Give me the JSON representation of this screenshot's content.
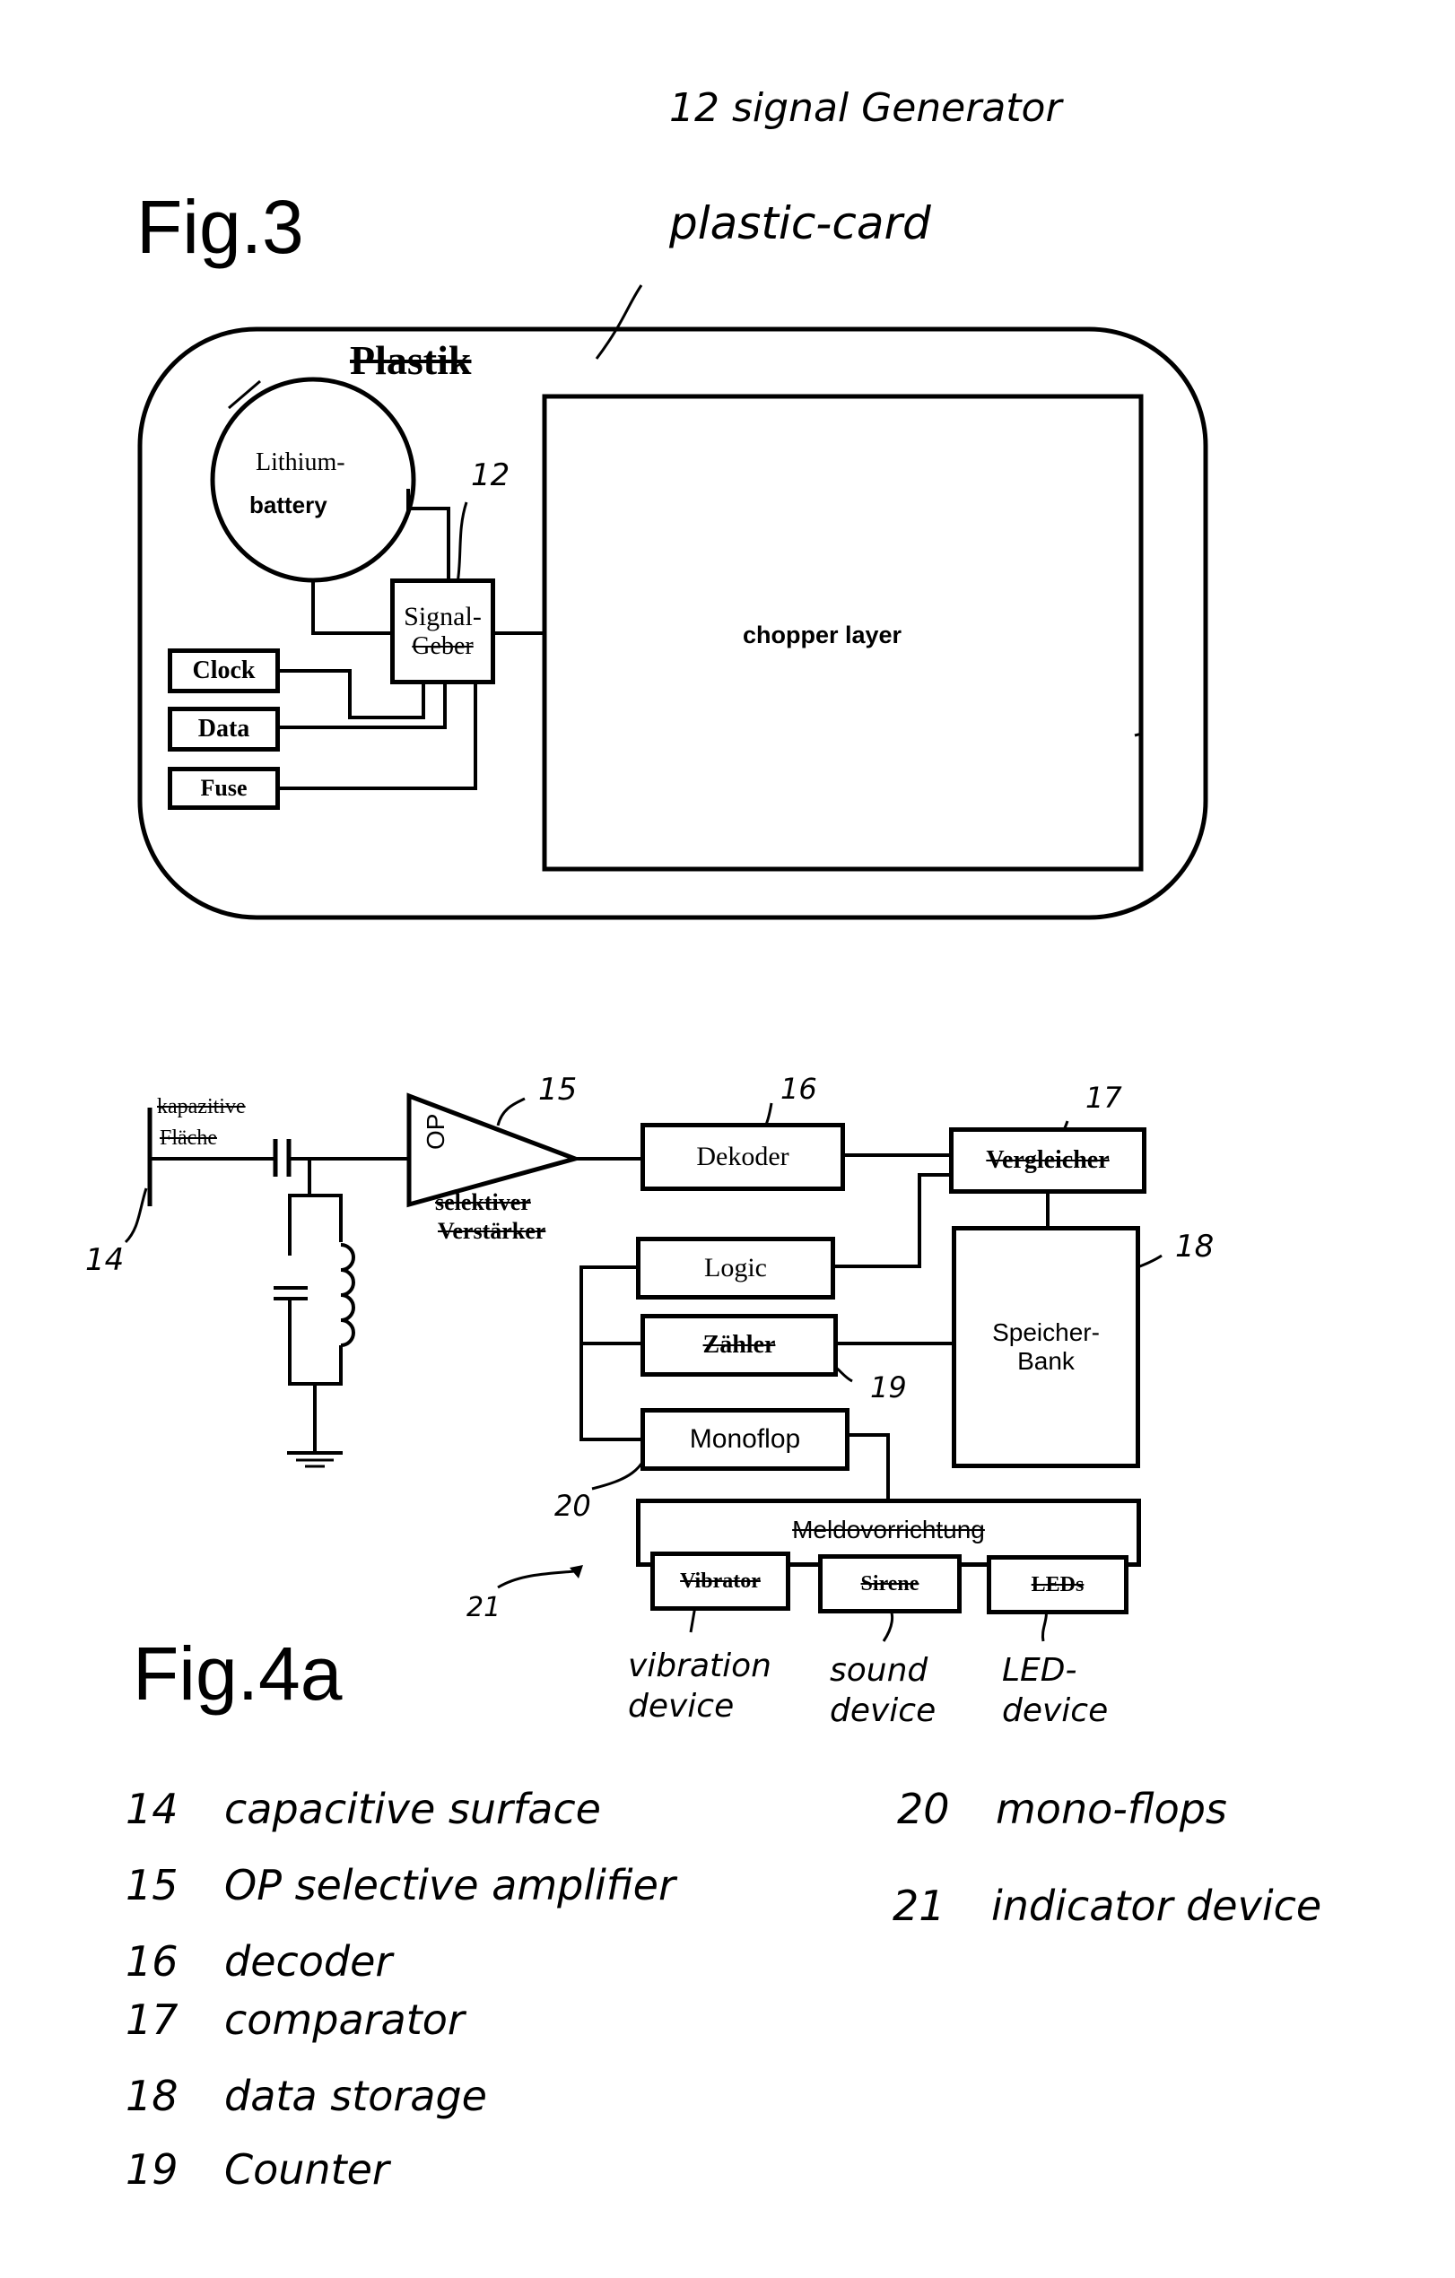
{
  "fig3": {
    "title": "Fig.3",
    "annotation_top": "12   signal  Generator",
    "annotation_card": "plastic-card",
    "card_label": "Plastik",
    "battery_line1": "Lithium-",
    "battery_line2": "battery",
    "signal_ref": "12",
    "signal_line1": "Signal-",
    "signal_line2": "Geber",
    "clock": "Clock",
    "data": "Data",
    "fuse": "Fuse",
    "chopper": "chopper layer"
  },
  "fig4a": {
    "title": "Fig.4a",
    "surface_line1": "kapazitive",
    "surface_line2": "Fläche",
    "ref14": "14",
    "op": "OP",
    "ref15": "15",
    "amp_line1": "selektiver",
    "amp_line2": "Verstärker",
    "decoder": "Dekoder",
    "ref16": "16",
    "comparator": "Vergleicher",
    "ref17": "17",
    "logic": "Logic",
    "counter": "Zähler",
    "ref19": "19",
    "monoflop": "Monoflop",
    "ref20": "20",
    "storage_line1": "Speicher-",
    "storage_line2": "Bank",
    "ref18": "18",
    "indicator": "Meldovorrichtung",
    "ref21": "21",
    "vibrator": "Vibrator",
    "sirene": "Sirene",
    "leds": "LEDs",
    "vibration_note_1": "vibration",
    "vibration_note_2": "device",
    "sound_note_1": "sound",
    "sound_note_2": "device",
    "led_note_1": "LED-",
    "led_note_2": "device"
  },
  "legend": [
    {
      "num": "14",
      "text": "capacitive surface"
    },
    {
      "num": "15",
      "text": "OP selective amplifier"
    },
    {
      "num": "16",
      "text": "decoder"
    },
    {
      "num": "17",
      "text": "comparator"
    },
    {
      "num": "18",
      "text": "data storage"
    },
    {
      "num": "19",
      "text": "Counter"
    },
    {
      "num": "20",
      "text": "mono-flops"
    },
    {
      "num": "21",
      "text": "indicator device"
    }
  ]
}
